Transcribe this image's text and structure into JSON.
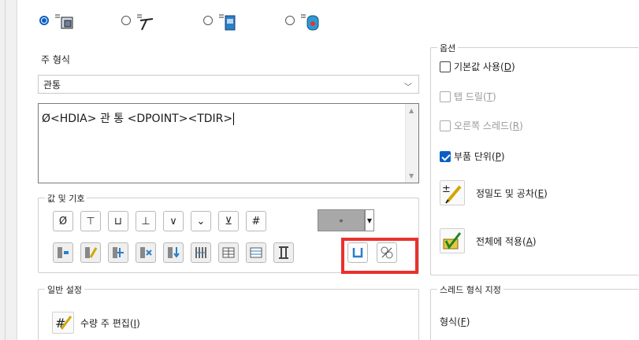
{
  "radio_options": [
    {
      "icon": "leader-note-icon",
      "selected": true
    },
    {
      "icon": "bent-leader-icon",
      "selected": false
    },
    {
      "icon": "multi-jog-leader-icon",
      "selected": false
    },
    {
      "icon": "hole-callout-icon",
      "selected": false
    }
  ],
  "main_format": {
    "title": "주 형식",
    "combo_value": "관통",
    "text": "Ø<HDIA> 관 통 <DPOINT><TDIR>"
  },
  "symbols": {
    "title": "값 및 기호",
    "row1": [
      "Ø",
      "⊤",
      "⊔",
      "⊥",
      "∨",
      "⌄",
      "⊻",
      "#"
    ],
    "dropdown_value": "∘",
    "row2_icons": [
      "hole-dim-icon",
      "edit-dim-icon",
      "dim-axis-icon",
      "remove-dim-icon",
      "depth-dim-icon",
      "pattern-icon",
      "table-grid-icon",
      "table-list-icon",
      "bolt-icon",
      "counterbore-icon",
      "thread-angle-icon"
    ]
  },
  "options": {
    "title": "옵션",
    "use_default": {
      "label": "기본값 사용",
      "key": "D"
    },
    "tap_drill": {
      "label": "탭 드릴",
      "key": "T"
    },
    "right_thread": {
      "label": "오른쪽 스레드",
      "key": "R"
    },
    "part_unit": {
      "label": "부품 단위",
      "key": "P",
      "checked": true
    },
    "precision": {
      "label": "정밀도 및 공차",
      "key": "E"
    },
    "apply_all": {
      "label": "전체에 적용",
      "key": "A"
    }
  },
  "general": {
    "title": "일반 설정",
    "edit_qty": {
      "label": "수량 주 편집",
      "key": "I"
    }
  },
  "thread": {
    "title": "스레드 형식 지정",
    "format": {
      "label": "형식",
      "key": "F"
    }
  },
  "colors": {
    "accent": "#0b5fc4",
    "highlight": "#e8322e"
  }
}
